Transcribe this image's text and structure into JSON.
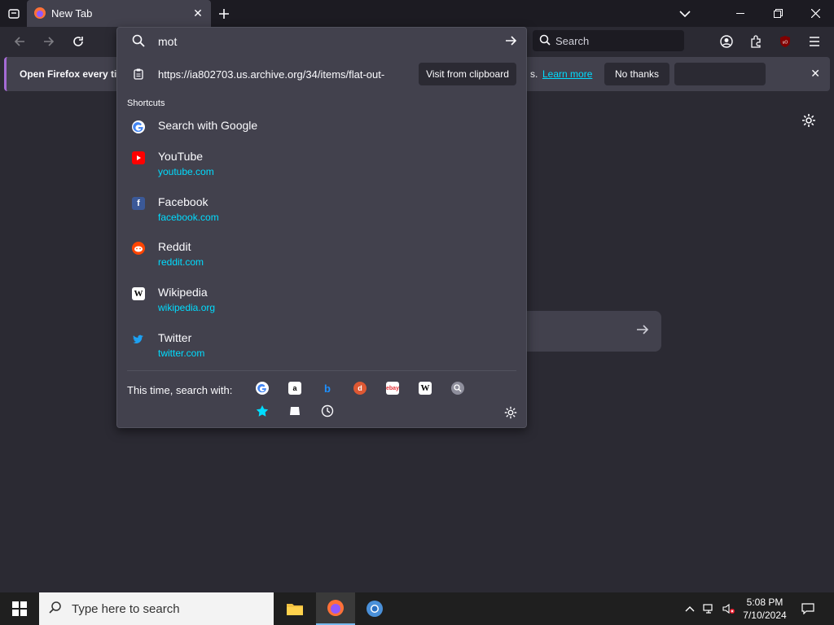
{
  "tabbar": {
    "tab_title": "New Tab"
  },
  "navbar": {
    "search_placeholder": "Search"
  },
  "notification": {
    "text": "Open Firefox every ti",
    "tail": "s.",
    "learn_more": "Learn more",
    "no_thanks": "No thanks"
  },
  "urlbar": {
    "value": "mot",
    "clipboard_url": "https://ia802703.us.archive.org/34/items/flat-out-",
    "clipboard_button": "Visit from clipboard",
    "shortcuts_label": "Shortcuts",
    "search_with_google": "Search with Google",
    "shortcuts": [
      {
        "title": "YouTube",
        "url": "youtube.com",
        "color": "#ff0000",
        "icon": "youtube-icon"
      },
      {
        "title": "Facebook",
        "url": "facebook.com",
        "color": "#3b5998",
        "icon": "facebook-icon"
      },
      {
        "title": "Reddit",
        "url": "reddit.com",
        "color": "#ff4500",
        "icon": "reddit-icon"
      },
      {
        "title": "Wikipedia",
        "url": "wikipedia.org",
        "color": "#ffffff",
        "icon": "wikipedia-icon"
      },
      {
        "title": "Twitter",
        "url": "twitter.com",
        "color": "#1da1f2",
        "icon": "twitter-icon"
      }
    ],
    "search_with_label": "This time, search with:",
    "engines": [
      "google-icon",
      "amazon-icon",
      "bing-icon",
      "duckduckgo-icon",
      "ebay-icon",
      "wikipedia-icon",
      "search-engine-icon",
      "bookmarks-icon",
      "tabs-icon",
      "history-icon"
    ]
  },
  "taskbar": {
    "search_placeholder": "Type here to search",
    "time": "5:08 PM",
    "date": "7/10/2024"
  },
  "colors": {
    "accent": "#00ddff",
    "popup_bg": "#42414d",
    "page_bg": "#2b2a33"
  }
}
